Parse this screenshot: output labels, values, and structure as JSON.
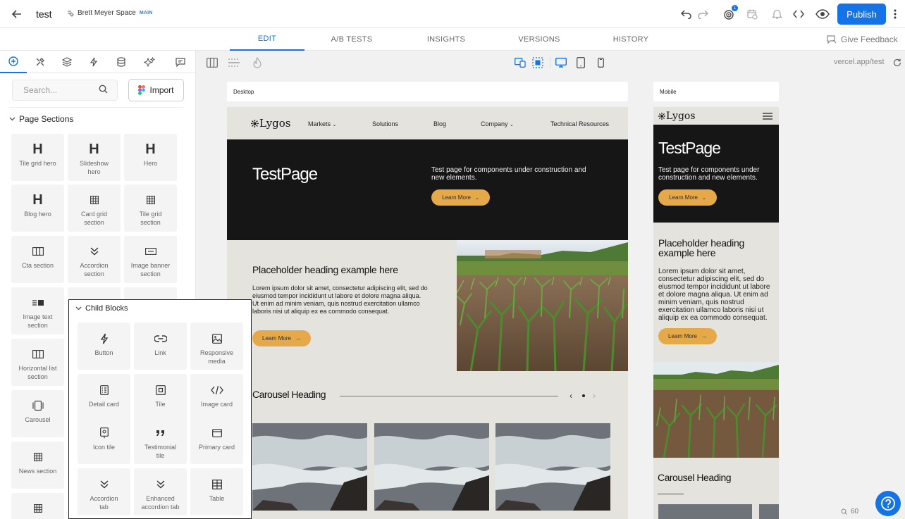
{
  "header": {
    "title": "test",
    "space_name": "Brett Meyer Space",
    "space_badge": "MAIN",
    "notification_count": "1",
    "publish_label": "Publish"
  },
  "tabs": [
    "EDIT",
    "A/B TESTS",
    "INSIGHTS",
    "VERSIONS",
    "HISTORY"
  ],
  "active_tab": "EDIT",
  "feedback_label": "Give Feedback",
  "sidebar": {
    "search_placeholder": "Search...",
    "import_label": "Import",
    "page_sections_title": "Page Sections",
    "page_sections": [
      {
        "label": "Tile grid hero",
        "icon": "heading-icon"
      },
      {
        "label": "Slideshow hero",
        "icon": "heading-icon"
      },
      {
        "label": "Hero",
        "icon": "heading-icon"
      },
      {
        "label": "Blog hero",
        "icon": "heading-icon"
      },
      {
        "label": "Card grid section",
        "icon": "grid-icon"
      },
      {
        "label": "Tile grid section",
        "icon": "grid-icon"
      },
      {
        "label": "Cta section",
        "icon": "columns-icon"
      },
      {
        "label": "Accordion section",
        "icon": "chevrons-down-icon"
      },
      {
        "label": "Image banner section",
        "icon": "banner-icon"
      },
      {
        "label": "Image text section",
        "icon": "image-text-icon"
      },
      {
        "label": "Horizontal list section",
        "icon": "columns-icon"
      },
      {
        "label": "Carousel",
        "icon": "carousel-icon"
      },
      {
        "label": "News section",
        "icon": "grid-icon"
      }
    ]
  },
  "child_blocks": {
    "title": "Child Blocks",
    "items": [
      {
        "label": "Button",
        "icon": "lightning-icon"
      },
      {
        "label": "Link",
        "icon": "link-icon"
      },
      {
        "label": "Responsive media",
        "icon": "image-icon"
      },
      {
        "label": "Detail card",
        "icon": "detail-card-icon"
      },
      {
        "label": "Tile",
        "icon": "tile-icon"
      },
      {
        "label": "Image card",
        "icon": "code-icon"
      },
      {
        "label": "Icon tile",
        "icon": "icon-tile-icon"
      },
      {
        "label": "Testimonial tile",
        "icon": "quote-icon"
      },
      {
        "label": "Primary card",
        "icon": "card-icon"
      },
      {
        "label": "Accordion tab",
        "icon": "chevrons-down-icon"
      },
      {
        "label": "Enhanced accordion tab",
        "icon": "chevrons-down-icon"
      },
      {
        "label": "Table",
        "icon": "table-icon"
      }
    ]
  },
  "canvas": {
    "url": "vercel.app/test",
    "zoom": "60",
    "desktop_label": "Desktop",
    "mobile_label": "Mobile"
  },
  "site": {
    "logo": "Lygos",
    "nav": [
      "Markets",
      "Solutions",
      "Blog",
      "Company",
      "Technical Resources"
    ],
    "hero_title": "TestPage",
    "hero_subtitle": "Test page for components under construction and new elements.",
    "hero_cta": "Learn More",
    "section_heading": "Placeholder heading example here",
    "section_body": "Lorem ipsum dolor sit amet, consectetur adipiscing elit, sed do eiusmod tempor incididunt ut labore et dolore magna aliqua. Ut enim ad minim veniam, quis nostrud exercitation ullamco laboris nisi ut aliquip ex ea commodo consequat.",
    "section_cta": "Learn More",
    "carousel_heading": "Carousel Heading"
  },
  "colors": {
    "accent": "#1473e6",
    "site_bg": "#e4e3dd",
    "hero_bg": "#161616",
    "cta": "#e6a94a"
  }
}
